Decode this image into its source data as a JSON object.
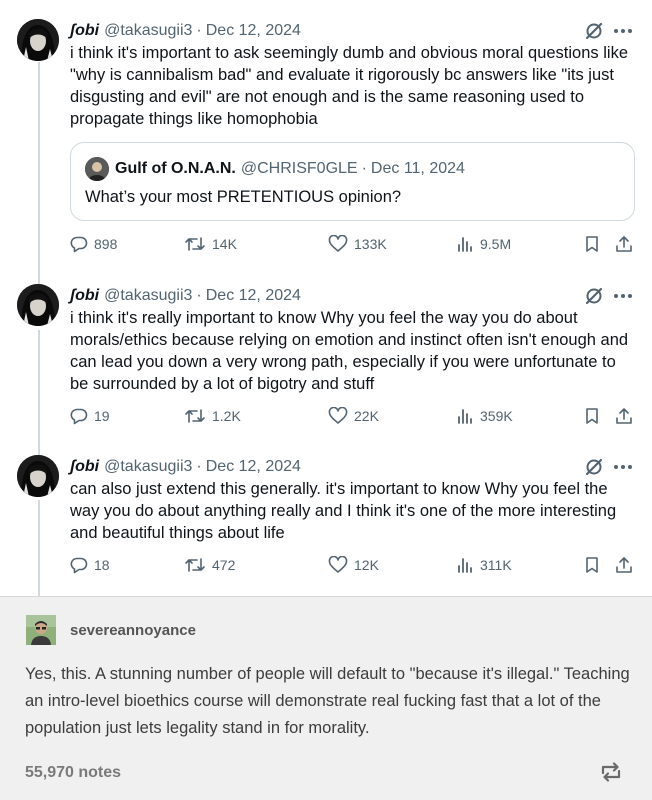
{
  "thread": {
    "tweets": [
      {
        "author": "ʃobi",
        "handle": "@takasugii3",
        "date": "Dec 12, 2024",
        "text": "i think it's important to ask seemingly dumb and obvious moral questions like \"why is cannibalism bad\" and evaluate it rigorously bc answers like \"its just disgusting and evil\" are not enough and is the same reasoning used to propagate things like homophobia",
        "quote": {
          "name": "Gulf of O.N.A.N.",
          "handle": "@CHRISF0GLE",
          "date": "Dec 11, 2024",
          "text": "What’s your most PRETENTIOUS opinion?"
        },
        "replies": "898",
        "retweets": "14K",
        "likes": "133K",
        "views": "9.5M"
      },
      {
        "author": "ʃobi",
        "handle": "@takasugii3",
        "date": "Dec 12, 2024",
        "text": "i think it's really important to know Why you feel the way you do about morals/ethics because relying on emotion and instinct often isn't enough and can lead you down a very wrong path, especially if you were unfortunate to be surrounded by a lot of bigotry and stuff",
        "replies": "19",
        "retweets": "1.2K",
        "likes": "22K",
        "views": "359K"
      },
      {
        "author": "ʃobi",
        "handle": "@takasugii3",
        "date": "Dec 12, 2024",
        "text": "can also just extend this generally. it's important to know Why you feel the way you do about anything really and I think it's one of the more interesting and beautiful things about life",
        "replies": "18",
        "retweets": "472",
        "likes": "12K",
        "views": "311K"
      }
    ]
  },
  "tumblr": {
    "username": "severeannoyance",
    "body": "Yes, this. A stunning number of people will default to \"because it's illegal.\" Teaching an intro-level bioethics course will demonstrate real fucking fast that a lot of the population just lets legality stand in for morality.",
    "notes": "55,970 notes"
  },
  "icons": {
    "grok": "grok-icon",
    "more": "more-icon",
    "reply": "reply-icon",
    "retweet": "retweet-icon",
    "like": "heart-icon",
    "views": "views-icon",
    "bookmark": "bookmark-icon",
    "share": "share-icon",
    "reblog": "reblog-icon"
  },
  "colors": {
    "text": "#0f1419",
    "muted": "#536471",
    "border": "#cfd9de",
    "tumblr_bg": "#f0f0f0"
  }
}
